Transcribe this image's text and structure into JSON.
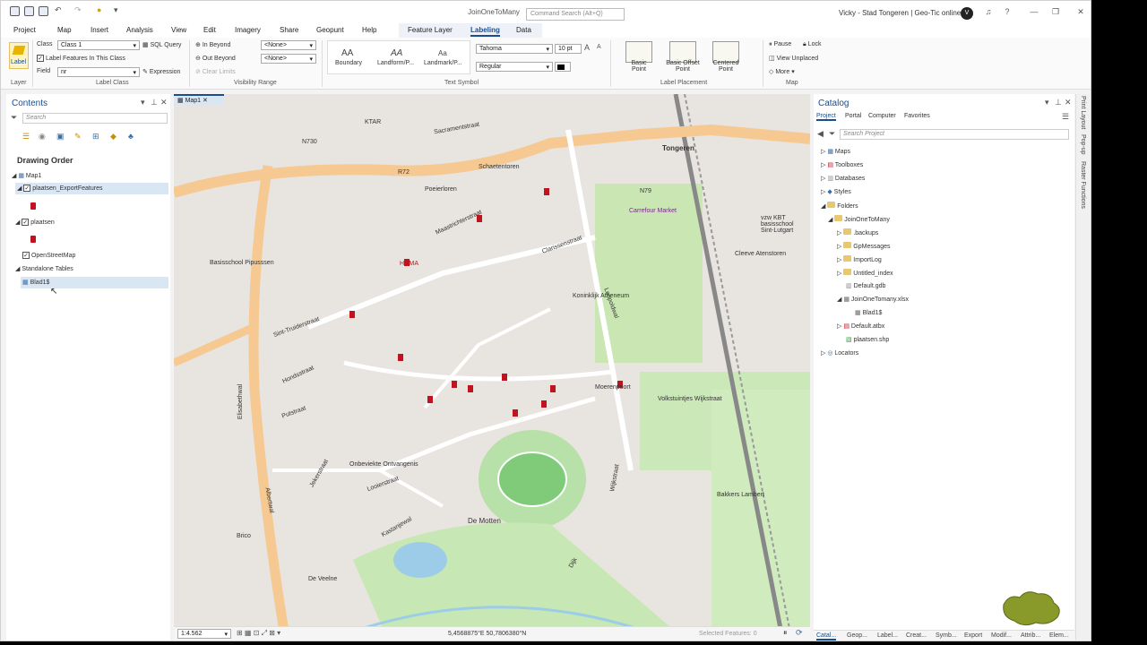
{
  "window": {
    "title": "JoinOneToMany",
    "command_search_placeholder": "Command Search (Alt+Q)",
    "user": "Vicky - Stad Tongeren | Geo-Tic online",
    "avatar_initials": "V"
  },
  "tabs": [
    "Project",
    "Map",
    "Insert",
    "Analysis",
    "View",
    "Edit",
    "Imagery",
    "Share",
    "Geopunt",
    "Help",
    "Feature Layer",
    "Labeling",
    "Data"
  ],
  "active_tab": "Labeling",
  "ribbon": {
    "layer_group": "Layer",
    "label_btn": "Label",
    "class_label": "Class",
    "class_value": "Class 1",
    "sql_query": "SQL Query",
    "label_features": "Label Features In This Class",
    "field_label": "Field",
    "field_value": "nr",
    "expression": "Expression",
    "label_class_group": "Label Class",
    "in_beyond": "In Beyond",
    "out_beyond": "Out Beyond",
    "clear_limits": "Clear Limits",
    "none1": "<None>",
    "none2": "<None>",
    "visibility_group": "Visibility Range",
    "styles": [
      "Boundary",
      "Landform/P...",
      "Landmark/P..."
    ],
    "style_glyphs": [
      "AA",
      "AA",
      "Aa"
    ],
    "font": "Tahoma",
    "font_size": "10 pt",
    "font_style": "Regular",
    "text_symbol_group": "Text Symbol",
    "placements": [
      "Basic Point",
      "Basic Offset Point",
      "Centered Point"
    ],
    "label_placement_group": "Label Placement",
    "pause": "Pause",
    "lock": "Lock",
    "view_unplaced": "View Unplaced",
    "more": "More",
    "map_group": "Map"
  },
  "contents": {
    "title": "Contents",
    "search_placeholder": "Search",
    "drawing_order": "Drawing Order",
    "items": [
      "Map1",
      "plaatsen_ExportFeatures",
      "plaatsen",
      "OpenStreetMap",
      "Standalone Tables",
      "Blad1$"
    ]
  },
  "map": {
    "tab": "Map1",
    "scale": "1:4.562",
    "coords": "5,4568875°E 50,7806380°N",
    "selected": "Selected Features: 0",
    "labels": [
      "Sacramentstraat",
      "Tongeren",
      "N79",
      "N730",
      "R72",
      "Maastrichterstraat",
      "Clarissenstraat",
      "Poeierloren",
      "Schaetentoren",
      "Sint-Truiderstraat",
      "Hondsstraat",
      "Putstraat",
      "Elisabethwal",
      "Leopoldwal",
      "Moerenpoort",
      "De Motten",
      "Volkstuintjes Wijkstraat",
      "Bakkers Lambert",
      "Koninklijk Atheneum",
      "Carrefour Market",
      "Brico",
      "Albertwal",
      "Looierstraat",
      "Jekerstraat",
      "Kastanjewal",
      "Basisschool Pipusssen",
      "Onbeviekte Ontvangenis",
      "Cleeve Atenstoren",
      "vzw KBT basisschool Sint-Lutgart",
      "Wijkstraat",
      "Dijk",
      "De Veelne",
      "HOMA",
      "KTAR"
    ]
  },
  "catalog": {
    "title": "Catalog",
    "tabs": [
      "Project",
      "Portal",
      "Computer",
      "Favorites"
    ],
    "search_placeholder": "Search Project",
    "items": [
      "Maps",
      "Toolboxes",
      "Databases",
      "Styles",
      "Folders",
      "JoinOneToMany",
      ".backups",
      "GpMessages",
      "ImportLog",
      "Untitled_index",
      "Default.gdb",
      "JoinOneTomany.xlsx",
      "Blad1$",
      "Default.atbx",
      "plaatsen.shp",
      "Locators"
    ]
  },
  "side_tabs": [
    "Print Layout",
    "Pop-up",
    "Raster Functions"
  ],
  "bottom_tabs": [
    "Catal...",
    "Geop...",
    "Label...",
    "Creat...",
    "Symb...",
    "Export",
    "Modif...",
    "Attrib...",
    "Elem..."
  ],
  "colors": {
    "accent": "#1a4d8c",
    "marker": "#c1121f",
    "road_major": "#f6c992",
    "park": "#c9e6b3"
  }
}
